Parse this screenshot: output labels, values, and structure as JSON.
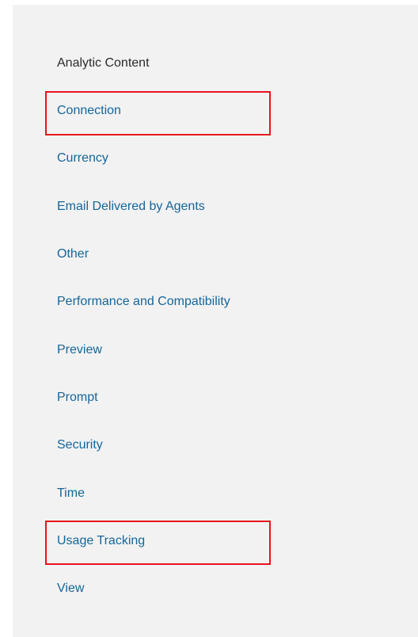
{
  "menu": {
    "heading": "Analytic Content",
    "items": [
      {
        "label": "Connection"
      },
      {
        "label": "Currency"
      },
      {
        "label": "Email Delivered by Agents"
      },
      {
        "label": "Other"
      },
      {
        "label": "Performance and Compatibility"
      },
      {
        "label": "Preview"
      },
      {
        "label": "Prompt"
      },
      {
        "label": "Security"
      },
      {
        "label": "Time"
      },
      {
        "label": "Usage Tracking"
      },
      {
        "label": "View"
      }
    ]
  },
  "colors": {
    "panel_background": "#f2f2f2",
    "link": "#15669a",
    "heading": "#2b2b2b",
    "highlight": "#e8141e"
  }
}
